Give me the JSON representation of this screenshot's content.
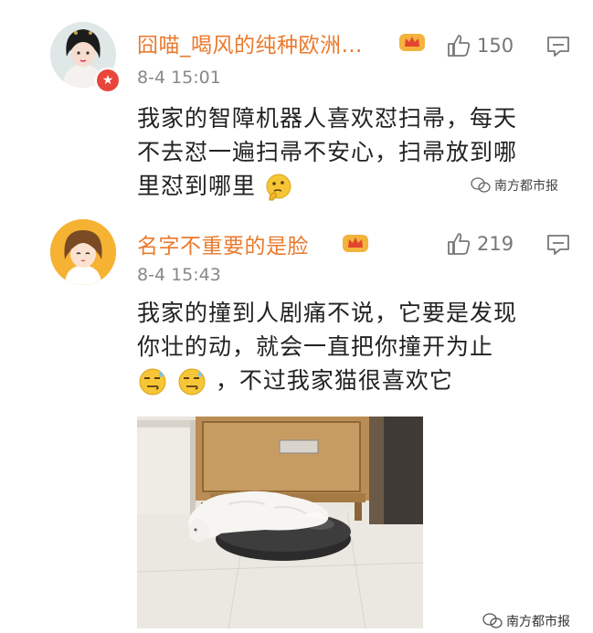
{
  "comments": [
    {
      "username": "囧喵_喝风的纯种欧洲…",
      "time": "8-4 15:01",
      "likes": "150",
      "lines": [
        "我家的智障机器人喜欢怼扫帚，每天",
        "不去怼一遍扫帚不安心，扫帚放到哪",
        "里怼到哪里"
      ],
      "emoji": "thinking-face"
    },
    {
      "username": "名字不重要的是脸",
      "time": "8-4 15:43",
      "likes": "219",
      "lines": [
        "我家的撞到人剧痛不说，它要是发现",
        "你壮的动，就会一直把你撞开为止",
        "，不过我家猫很喜欢它"
      ],
      "emoji": "smirk-face"
    }
  ],
  "watermark": {
    "text": "南方都市报"
  },
  "colors": {
    "username": "#ea7a2c",
    "badge": "#e8463b",
    "text": "#222222",
    "meta": "#888888"
  },
  "photo": {
    "description_icon": "cat-on-robot-vacuum-photo"
  }
}
